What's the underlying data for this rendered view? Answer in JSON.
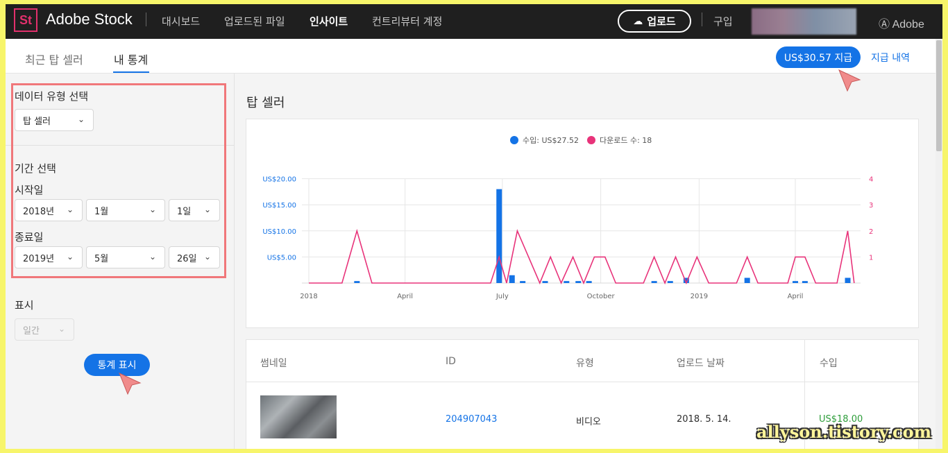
{
  "topbar": {
    "logo": "St",
    "brand": "Adobe Stock",
    "nav": [
      "대시보드",
      "업로드된 파일",
      "인사이트",
      "컨트리뷰터 계정"
    ],
    "upload_label": "업로드",
    "buy_label": "구입",
    "adobe_label": "Adobe"
  },
  "subtabs": {
    "items": [
      "최근 탑 셀러",
      "내 통계"
    ],
    "payout_label": "US$30.57 지급",
    "payout_history_label": "지급 내역"
  },
  "sidebar": {
    "data_type_label": "데이터 유형 선택",
    "data_type_value": "탑 셀러",
    "period_label": "기간 선택",
    "start_label": "시작일",
    "start": {
      "year": "2018년",
      "month": "1월",
      "day": "1일"
    },
    "end_label": "종료일",
    "end": {
      "year": "2019년",
      "month": "5월",
      "day": "26일"
    },
    "display_label": "표시",
    "display_value": "일간",
    "show_stats_label": "통계 표시"
  },
  "main": {
    "title": "탑 셀러",
    "legend": {
      "revenue": "수입: US$27.52",
      "downloads": "다운로드 수: 18"
    },
    "table": {
      "headers": [
        "썸네일",
        "ID",
        "유형",
        "업로드 날짜",
        "수입"
      ],
      "rows": [
        {
          "id": "204907043",
          "type": "비디오",
          "date": "2018. 5. 14.",
          "revenue": "US$18.00"
        }
      ]
    }
  },
  "chart_data": {
    "type": "bar",
    "title": "",
    "x_ticks": [
      "2018",
      "April",
      "July",
      "October",
      "2019",
      "April"
    ],
    "y_left_ticks": [
      "US$5.00",
      "US$10.00",
      "US$15.00",
      "US$20.00"
    ],
    "y_right_ticks": [
      "1",
      "2",
      "3",
      "4"
    ],
    "ylim_left": [
      0,
      25
    ],
    "ylim_right": [
      0,
      5
    ],
    "colors": {
      "revenue": "#1473e6",
      "downloads": "#e8337a"
    },
    "series": [
      {
        "name": "수입",
        "kind": "bar",
        "points": [
          {
            "x": "2018-02-15",
            "y": 0.38
          },
          {
            "x": "2018-06-28",
            "y": 18.0
          },
          {
            "x": "2018-07-10",
            "y": 1.5
          },
          {
            "x": "2018-07-20",
            "y": 0.38
          },
          {
            "x": "2018-08-10",
            "y": 0.38
          },
          {
            "x": "2018-08-30",
            "y": 0.38
          },
          {
            "x": "2018-09-10",
            "y": 0.38
          },
          {
            "x": "2018-09-20",
            "y": 0.38
          },
          {
            "x": "2018-11-20",
            "y": 0.38
          },
          {
            "x": "2018-12-05",
            "y": 0.38
          },
          {
            "x": "2018-12-20",
            "y": 1.0
          },
          {
            "x": "2019-02-15",
            "y": 1.0
          },
          {
            "x": "2019-04-01",
            "y": 0.38
          },
          {
            "x": "2019-04-10",
            "y": 0.38
          },
          {
            "x": "2019-05-20",
            "y": 1.0
          }
        ]
      },
      {
        "name": "다운로드 수",
        "kind": "line",
        "points": [
          {
            "x": "2018-01-01",
            "y": 0
          },
          {
            "x": "2018-02-01",
            "y": 0
          },
          {
            "x": "2018-02-15",
            "y": 2
          },
          {
            "x": "2018-03-01",
            "y": 0
          },
          {
            "x": "2018-06-20",
            "y": 0
          },
          {
            "x": "2018-06-28",
            "y": 1
          },
          {
            "x": "2018-07-05",
            "y": 0
          },
          {
            "x": "2018-07-15",
            "y": 2
          },
          {
            "x": "2018-08-05",
            "y": 0
          },
          {
            "x": "2018-08-15",
            "y": 1
          },
          {
            "x": "2018-08-25",
            "y": 0
          },
          {
            "x": "2018-09-05",
            "y": 1
          },
          {
            "x": "2018-09-15",
            "y": 0
          },
          {
            "x": "2018-09-25",
            "y": 1
          },
          {
            "x": "2018-10-05",
            "y": 1
          },
          {
            "x": "2018-10-15",
            "y": 0
          },
          {
            "x": "2018-11-10",
            "y": 0
          },
          {
            "x": "2018-11-20",
            "y": 1
          },
          {
            "x": "2018-11-30",
            "y": 0
          },
          {
            "x": "2018-12-10",
            "y": 1
          },
          {
            "x": "2018-12-20",
            "y": 0
          },
          {
            "x": "2018-12-30",
            "y": 1
          },
          {
            "x": "2019-01-10",
            "y": 0
          },
          {
            "x": "2019-02-05",
            "y": 0
          },
          {
            "x": "2019-02-15",
            "y": 1
          },
          {
            "x": "2019-02-25",
            "y": 0
          },
          {
            "x": "2019-03-25",
            "y": 0
          },
          {
            "x": "2019-04-01",
            "y": 1
          },
          {
            "x": "2019-04-10",
            "y": 1
          },
          {
            "x": "2019-04-20",
            "y": 0
          },
          {
            "x": "2019-05-10",
            "y": 0
          },
          {
            "x": "2019-05-20",
            "y": 2
          },
          {
            "x": "2019-05-26",
            "y": 0
          }
        ]
      }
    ]
  },
  "watermark": "allyson.tistory.com"
}
